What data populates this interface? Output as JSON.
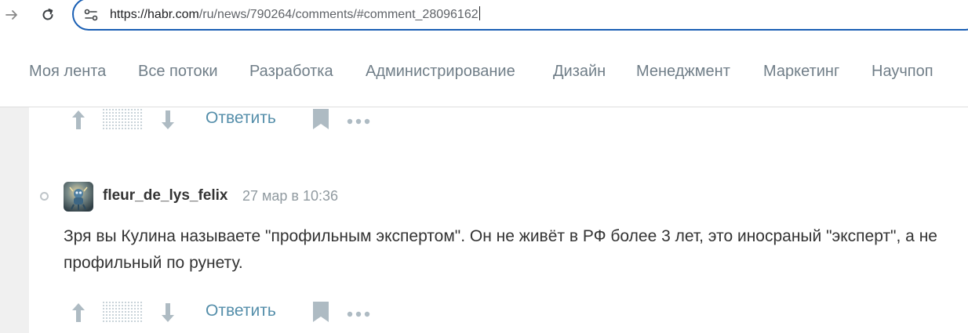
{
  "browser": {
    "url_host": "https://habr.com",
    "url_path": "/ru/news/790264/comments/#comment_28096162"
  },
  "nav": {
    "items": [
      {
        "label": "Моя лента"
      },
      {
        "label": "Все потоки"
      },
      {
        "label": "Разработка"
      },
      {
        "label": "Администрирование"
      },
      {
        "label": "Дизайн"
      },
      {
        "label": "Менеджмент"
      },
      {
        "label": "Маркетинг"
      },
      {
        "label": "Научпоп"
      }
    ]
  },
  "comments": {
    "prev_footer": {
      "reply_label": "Ответить"
    },
    "comment": {
      "username": "fleur_de_lys_felix",
      "time": "27 мар в 10:36",
      "text": "Зря вы Кулина называете \"профильным экспертом\". Он не живёт в РФ более 3 лет, это иносраный \"эксперт\", а не профильный по рунету.",
      "reply_label": "Ответить"
    }
  },
  "colors": {
    "accent_link": "#548eaa",
    "nav_text": "#707e88",
    "address_border": "#1a5fb4",
    "icon_gray": "#aebbc3"
  },
  "icons": [
    "forward-icon",
    "reload-icon",
    "site-settings-icon",
    "vote-up-icon",
    "vote-down-icon",
    "bookmark-icon",
    "more-icon"
  ]
}
